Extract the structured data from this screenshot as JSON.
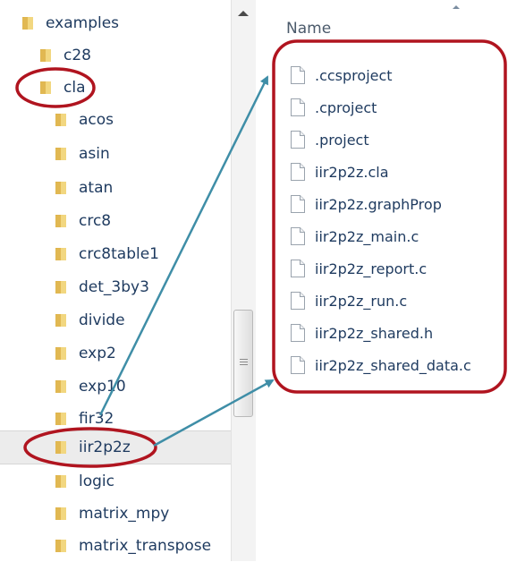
{
  "tree": {
    "items": [
      {
        "label": "examples"
      },
      {
        "label": "c28"
      },
      {
        "label": "cla"
      },
      {
        "label": "acos"
      },
      {
        "label": "asin"
      },
      {
        "label": "atan"
      },
      {
        "label": "crc8"
      },
      {
        "label": "crc8table1"
      },
      {
        "label": "det_3by3"
      },
      {
        "label": "divide"
      },
      {
        "label": "exp2"
      },
      {
        "label": "exp10"
      },
      {
        "label": "fir32"
      },
      {
        "label": "iir2p2z"
      },
      {
        "label": "logic"
      },
      {
        "label": "matrix_mpy"
      },
      {
        "label": "matrix_transpose"
      }
    ]
  },
  "files": {
    "column_header": "Name",
    "items": [
      {
        "name": ".ccsproject"
      },
      {
        "name": ".cproject"
      },
      {
        "name": ".project"
      },
      {
        "name": "iir2p2z.cla"
      },
      {
        "name": "iir2p2z.graphProp"
      },
      {
        "name": "iir2p2z_main.c"
      },
      {
        "name": "iir2p2z_report.c"
      },
      {
        "name": "iir2p2z_run.c"
      },
      {
        "name": "iir2p2z_shared.h"
      },
      {
        "name": "iir2p2z_shared_data.c"
      }
    ]
  },
  "colors": {
    "annotation_red": "#b0141f",
    "arrow_teal": "#3f8ea7",
    "folder_yellow": "#e8c35a",
    "text_blue": "#1e3a5f"
  }
}
